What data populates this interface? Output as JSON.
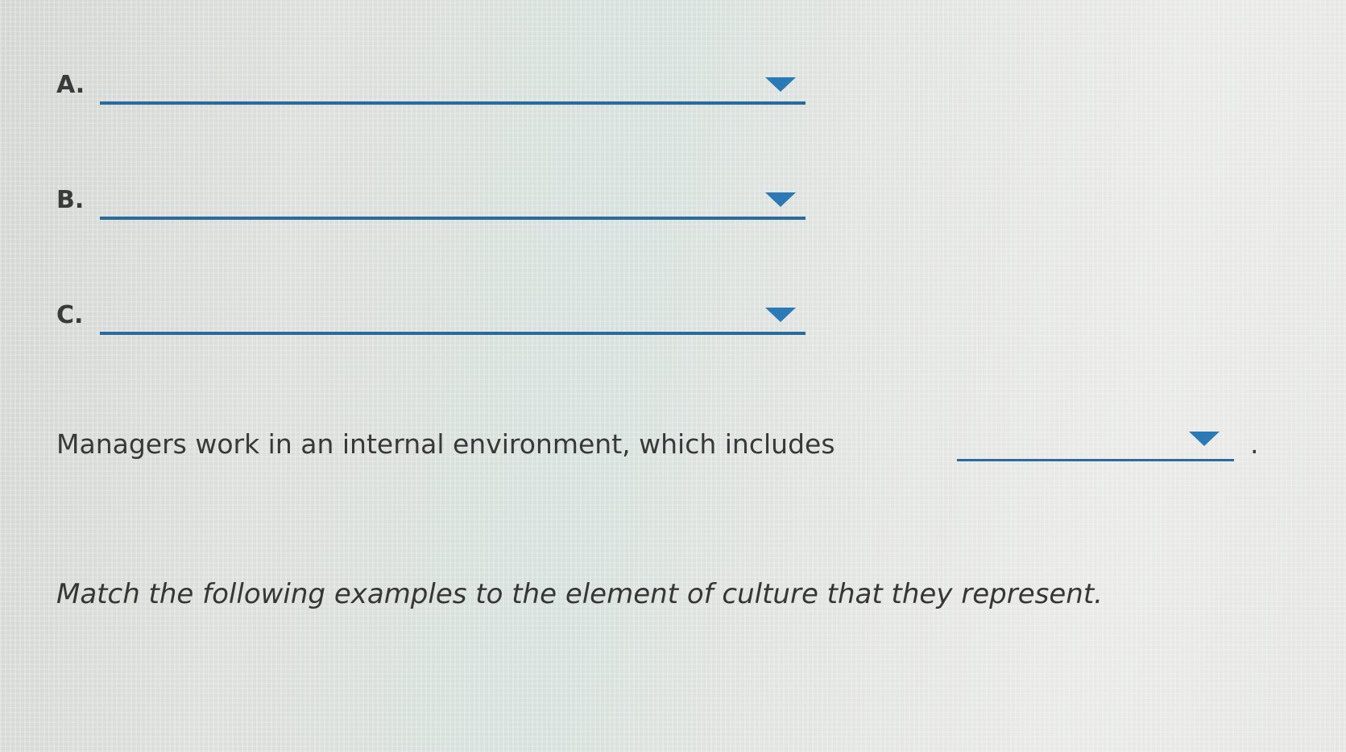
{
  "items": [
    {
      "letter": "A.",
      "selected_value": ""
    },
    {
      "letter": "B.",
      "selected_value": ""
    },
    {
      "letter": "C.",
      "selected_value": ""
    }
  ],
  "sentence": {
    "text": "Managers work in an internal environment, which includes",
    "selected_value": "",
    "ending": "."
  },
  "instruction": "Match the following examples to the element of culture that they represent.",
  "icons": {
    "dropdown": "caret-down-icon"
  },
  "colors": {
    "dropdown_line": "#2b6a9c",
    "caret": "#2b79b5",
    "text": "#3b3b3b"
  }
}
